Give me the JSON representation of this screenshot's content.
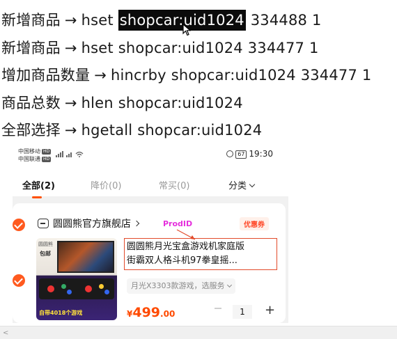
{
  "commands": [
    {
      "label": "新增商品",
      "arrow": "→",
      "cmd": "hset",
      "key": "shopcar:uid1024",
      "args": "334488 1",
      "highlight_key": true
    },
    {
      "label": "新增商品",
      "arrow": "→",
      "cmd": "hset",
      "key": "shopcar:uid1024",
      "args": "334477 1",
      "highlight_key": false
    },
    {
      "label": "增加商品数量",
      "arrow": "→",
      "cmd": "hincrby",
      "key": "shopcar:uid1024",
      "args": "334477 1",
      "highlight_key": false
    },
    {
      "label": "商品总数",
      "arrow": "→",
      "cmd": "hlen",
      "key": "shopcar:uid1024",
      "args": "",
      "highlight_key": false
    },
    {
      "label": "全部选择",
      "arrow": "→",
      "cmd": "hgetall",
      "key": "shopcar:uid1024",
      "args": "",
      "highlight_key": false
    }
  ],
  "status_bar": {
    "carrier1": "中国移动",
    "carrier2": "中国联通",
    "hd": "HD",
    "battery": "67",
    "time": "19:30"
  },
  "tabs": [
    {
      "label": "全部(2)",
      "active": true
    },
    {
      "label": "降价(0)",
      "active": false
    },
    {
      "label": "常买(0)",
      "active": false
    },
    {
      "label": "分类",
      "active": false
    }
  ],
  "card": {
    "store_name": "圆圆熊官方旗舰店",
    "prodid_label": "ProdID",
    "coupon": "优惠券",
    "thumb_brand": "圆圆熊",
    "thumb_baoyou": "包邮",
    "thumb_promo": "自带4018个游戏",
    "title_line1": "圆圆熊月光宝盒游戏机家庭版",
    "title_line2": "街霸双人格斗机97拳皇摇...",
    "sku": "月光X3303款游戏，选服务",
    "price_currency": "¥",
    "price_int": "499",
    "price_dec": ".00",
    "quantity": "1",
    "minus": "—",
    "plus": "+"
  },
  "colors": {
    "accent": "#ff5000",
    "check": "#ff5a1f",
    "prodid": "#e52fdc",
    "title_border": "#e24a2a",
    "price": "#ff4a00"
  },
  "bottom": {
    "scroll_arrow": "<"
  }
}
